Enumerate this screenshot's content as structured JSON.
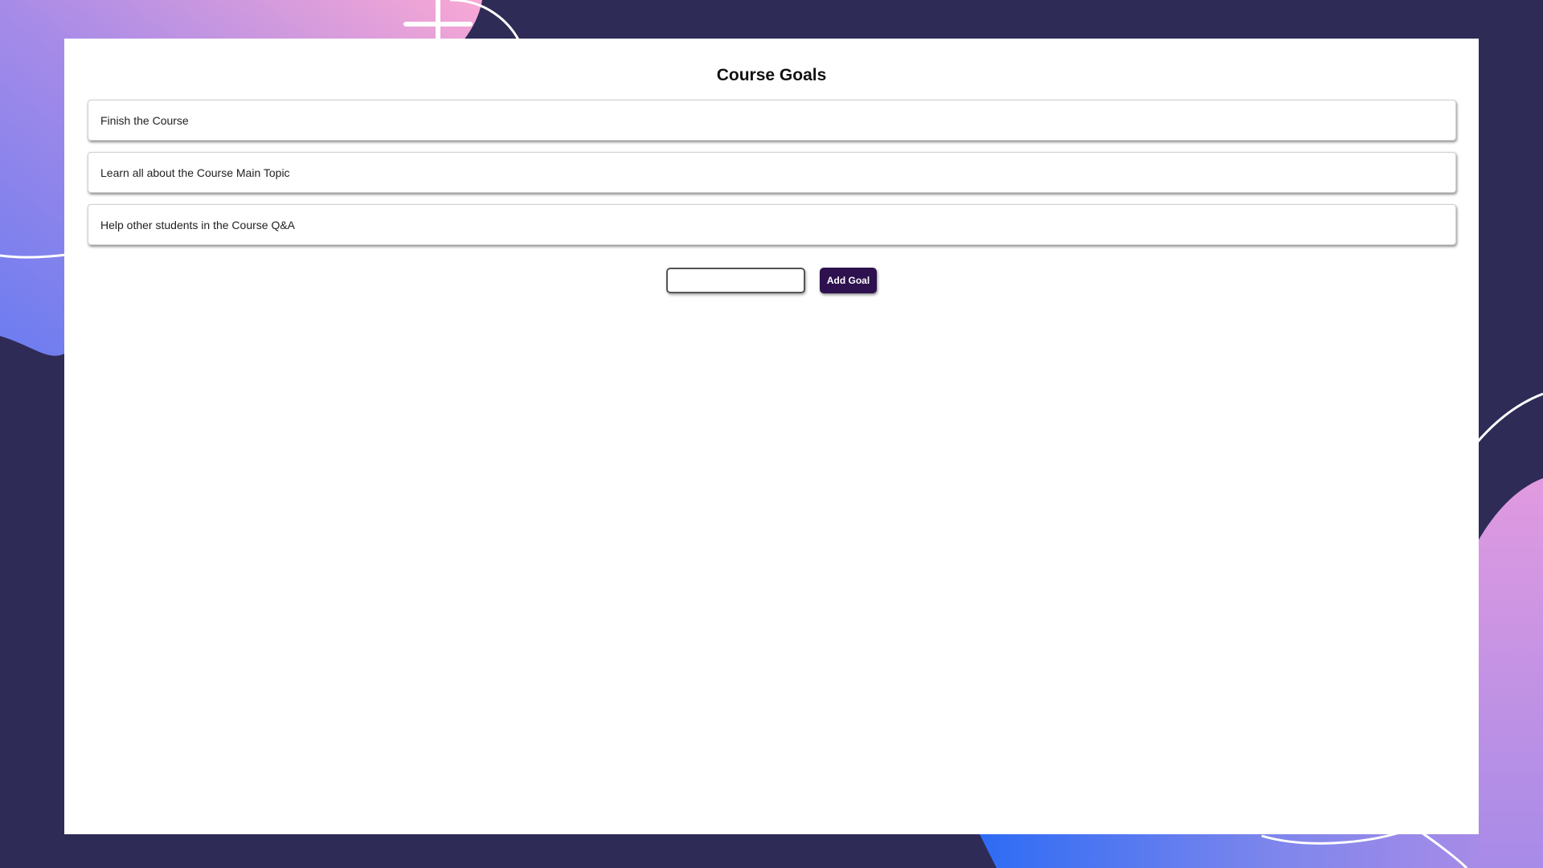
{
  "page": {
    "title": "Course Goals"
  },
  "goals": [
    {
      "text": "Finish the Course"
    },
    {
      "text": "Learn all about the Course Main Topic"
    },
    {
      "text": "Help other students in the Course Q&A"
    }
  ],
  "goal_form": {
    "input_value": "",
    "button_label": "Add Goal"
  },
  "colors": {
    "background": "#2e2b56",
    "panel": "#ffffff",
    "button": "#2e114f",
    "gradient_pink": "#f9a8d4",
    "gradient_purple": "#a78be8",
    "gradient_blue": "#6b7cf0"
  }
}
